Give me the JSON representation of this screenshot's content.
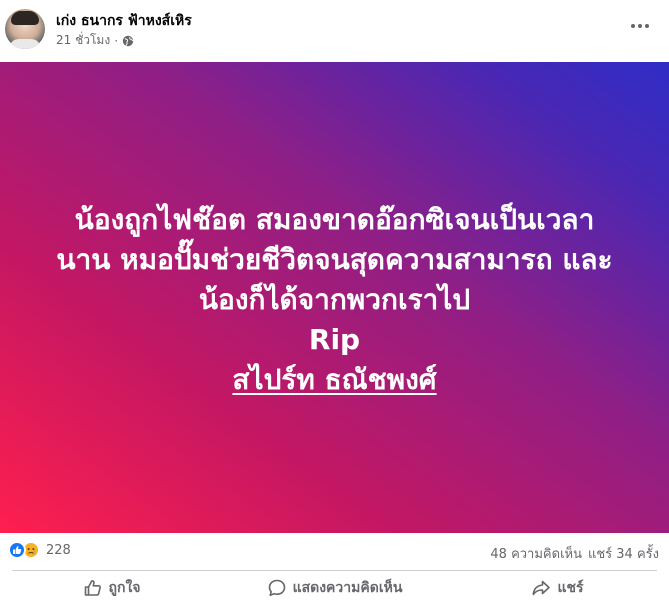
{
  "post": {
    "author": "เก่ง ธนากร ฟ้าหงส์เหิร",
    "time": "21 ชั่วโมง",
    "separator": "·",
    "audience_icon": "globe-icon",
    "menu_icon": "more-horizontal-icon"
  },
  "hero": {
    "background_colors": [
      "#ff1f4e",
      "#c41763",
      "#8f1f86",
      "#4a27b3",
      "#2f2dc7"
    ],
    "line1": "น้องถูกไฟช๊อต สมองขาดอ๊อกซิเจนเป็นเวลา",
    "line2": "นาน หมอปั๊มช่วยชีวิตจนสุดความสามารถ และ",
    "line3": "น้องก็ได้จากพวกเราไป",
    "line4": "Rip",
    "link": "สไปร์ท ธณัชพงศ์"
  },
  "stats": {
    "reaction_icons": [
      "like-icon",
      "sad-icon"
    ],
    "reaction_count": "228",
    "comments": "48 ความคิดเห็น",
    "shares": "แชร์ 34 ครั้ง"
  },
  "actions": {
    "like": "ถูกใจ",
    "comment": "แสดงความคิดเห็น",
    "share": "แชร์"
  },
  "colors": {
    "accent": "#1877f2",
    "secondary_text": "#65676b"
  }
}
